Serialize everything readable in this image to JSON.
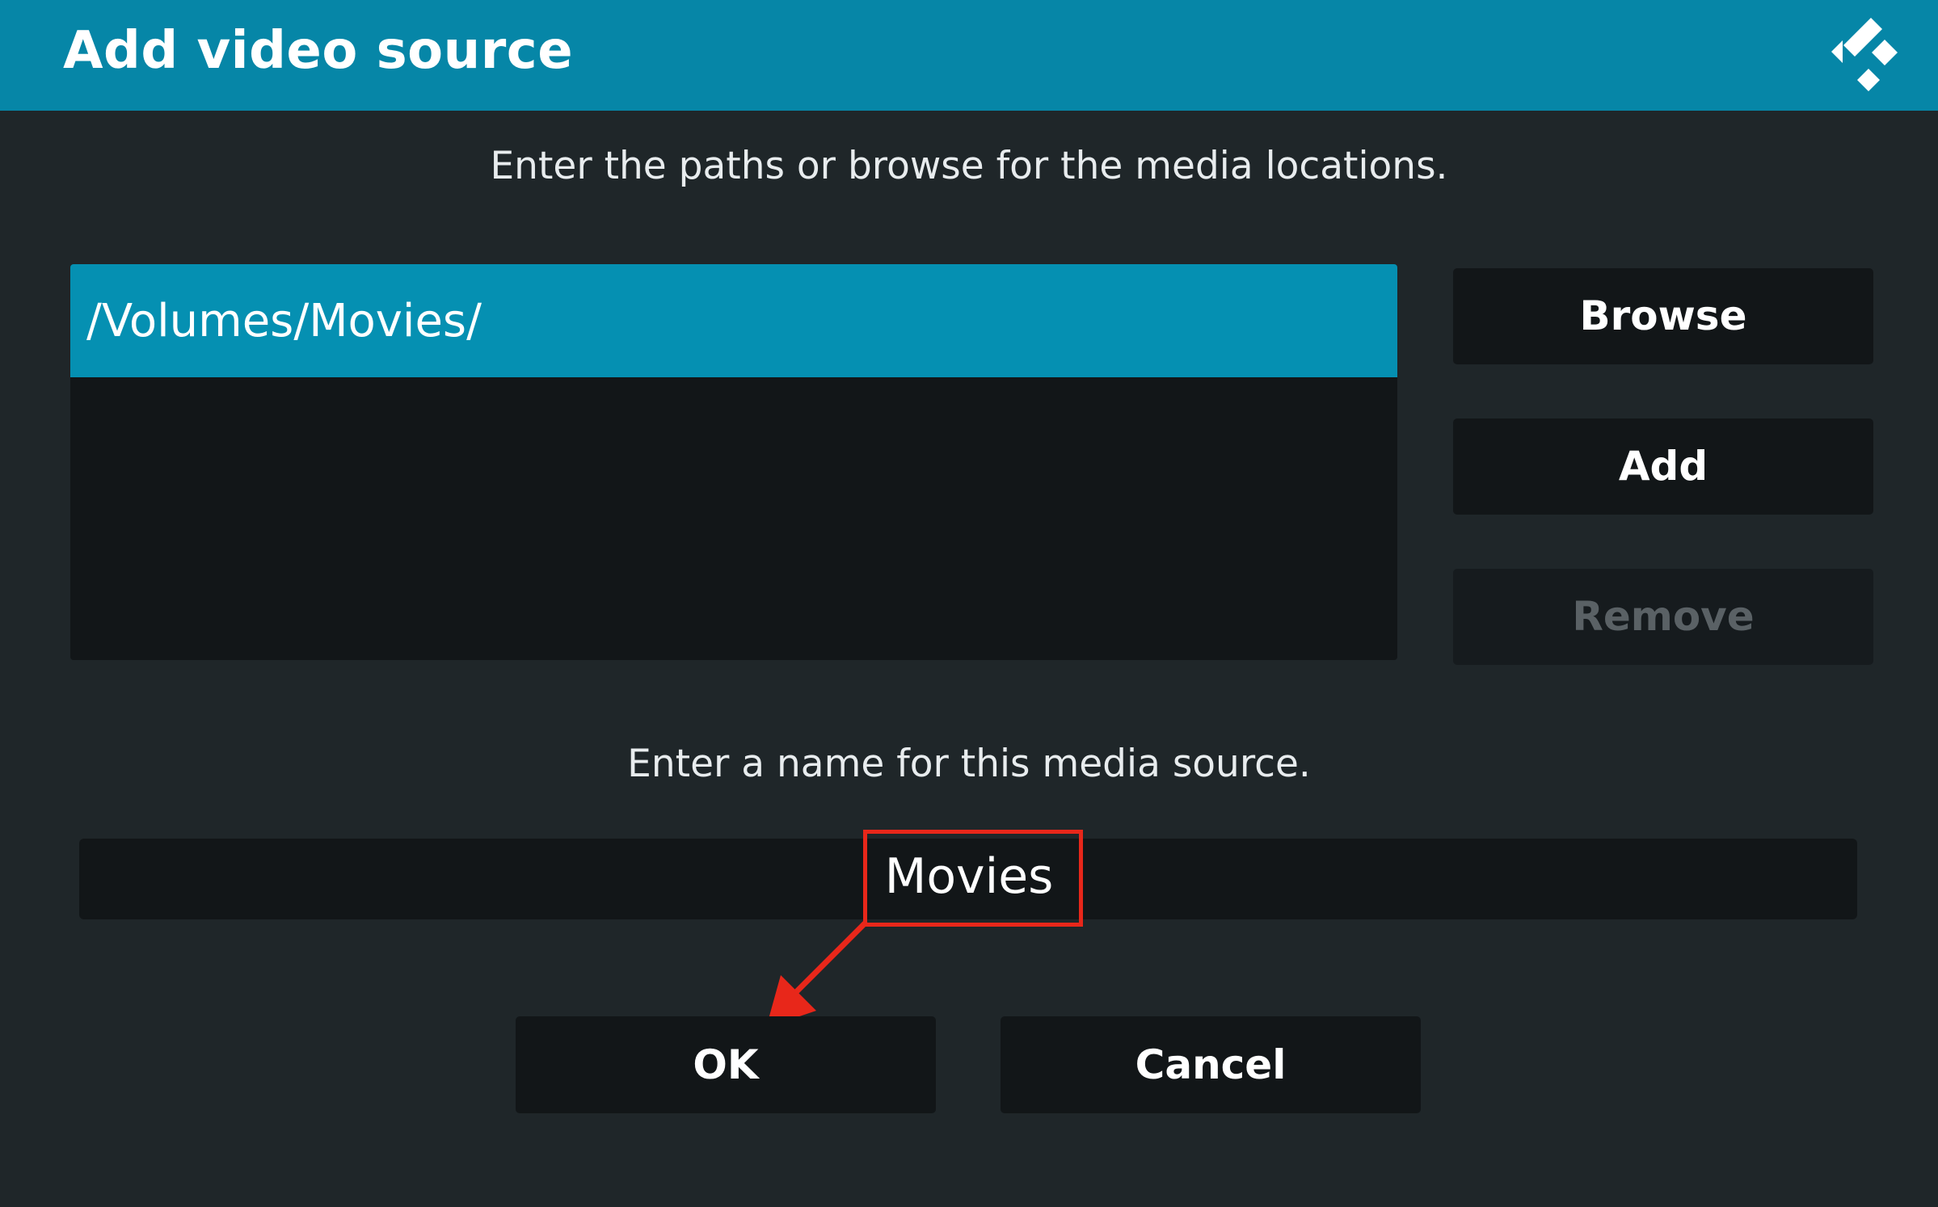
{
  "header": {
    "title": "Add video source",
    "logo_icon": "kodi-logo-icon"
  },
  "instructions": {
    "paths": "Enter the paths or browse for the media locations.",
    "name": "Enter a name for this media source."
  },
  "path_list": {
    "items": [
      {
        "label": "/Volumes/Movies/",
        "selected": true
      }
    ]
  },
  "side_buttons": {
    "browse": "Browse",
    "add": "Add",
    "remove": "Remove"
  },
  "name_field": {
    "value": "Movies"
  },
  "dialog_buttons": {
    "ok": "OK",
    "cancel": "Cancel"
  },
  "annotation": {
    "color": "#e8271a",
    "arrow_icon": "arrow-down-left-icon"
  },
  "colors": {
    "header": "#0686a7",
    "selection": "#0590b2",
    "background": "#1f2629",
    "control": "#121618"
  }
}
